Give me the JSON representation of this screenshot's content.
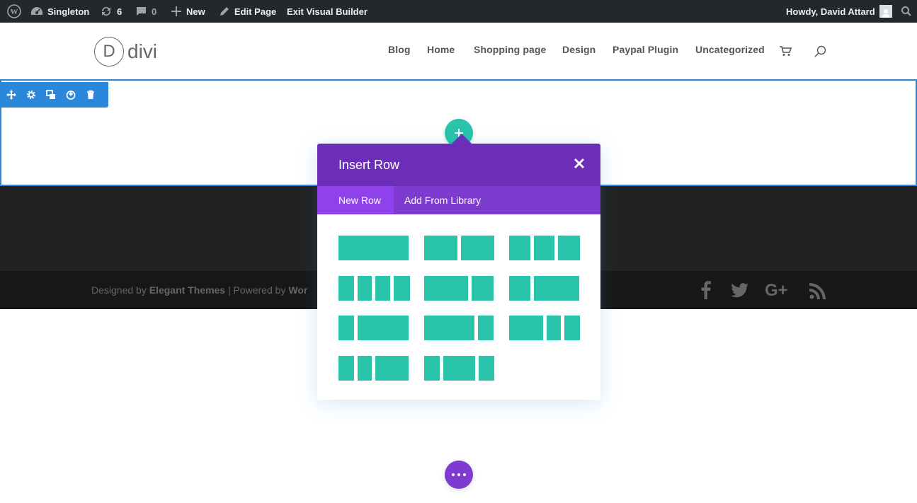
{
  "adminbar": {
    "site_name": "Singleton",
    "updates_count": "6",
    "comments_count": "0",
    "new_label": "New",
    "edit_label": "Edit Page",
    "exit_label": "Exit Visual Builder",
    "howdy": "Howdy, David Attard"
  },
  "header": {
    "logo_letter": "D",
    "logo_text": "divi",
    "nav": [
      "Blog",
      "Home",
      "Shopping page",
      "Design",
      "Paypal Plugin",
      "Uncategorized"
    ]
  },
  "modal": {
    "title": "Insert Row",
    "tabs": [
      "New Row",
      "Add From Library"
    ],
    "active_tab": "New Row",
    "layouts": [
      "1",
      "1/2 + 1/2",
      "1/3 + 1/3 + 1/3",
      "1/4 + 1/4 + 1/4 + 1/4",
      "2/3 + 1/3",
      "1/3 + 2/3",
      "1/4 + 3/4",
      "3/4 + 1/4",
      "1/2 + 1/4 + 1/4",
      "1/4 + 1/4 + 1/2",
      "1/4 + 1/2 + 1/4"
    ]
  },
  "footer": {
    "credits_prefix": "Designed by ",
    "credits_brand": "Elegant Themes",
    "credits_sep": " | Powered by ",
    "credits_wp": "Wor"
  },
  "colors": {
    "accent_blue": "#2b87da",
    "teal": "#29c4a9",
    "purple": "#6c2eb9",
    "purple_tab": "#7e3bd0"
  }
}
